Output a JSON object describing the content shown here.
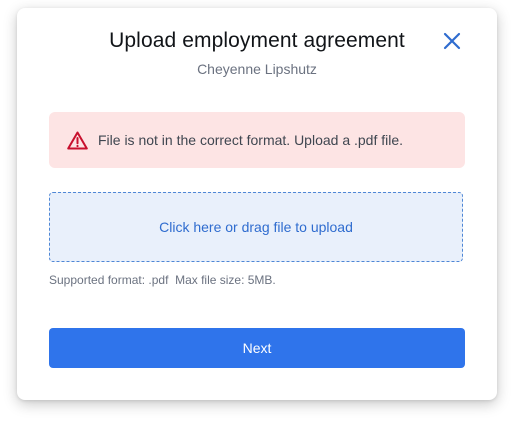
{
  "modal": {
    "title": "Upload employment agreement",
    "subtitle": "Cheyenne Lipshutz",
    "close_icon": "close-icon"
  },
  "alert": {
    "icon": "warning-triangle-icon",
    "message": "File is not in the correct format. Upload a .pdf file.",
    "color": "#c8102e",
    "background": "#fde4e4"
  },
  "dropzone": {
    "label": "Click here or drag file to upload"
  },
  "hint": {
    "text": "Supported format: .pdf  Max file size: 5MB."
  },
  "actions": {
    "next_label": "Next",
    "accent": "#2f74eb"
  }
}
